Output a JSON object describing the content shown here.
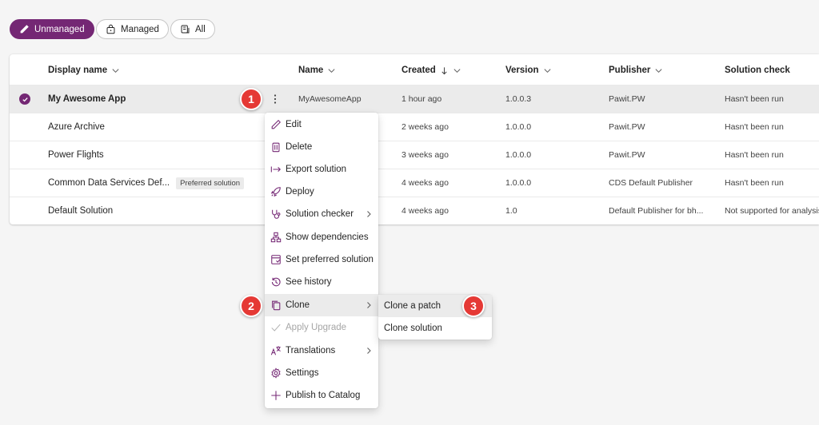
{
  "filters": [
    {
      "label": "Unmanaged",
      "active": true
    },
    {
      "label": "Managed",
      "active": false
    },
    {
      "label": "All",
      "active": false
    }
  ],
  "table": {
    "columns": {
      "display_name": "Display name",
      "name": "Name",
      "created": "Created",
      "version": "Version",
      "publisher": "Publisher",
      "solution_check": "Solution check"
    },
    "rows": [
      {
        "display_name": "My Awesome App",
        "tag": "",
        "name": "MyAwesomeApp",
        "created": "1 hour ago",
        "version": "1.0.0.3",
        "publisher": "Pawit.PW",
        "solution_check": "Hasn't been run"
      },
      {
        "display_name": "Azure Archive",
        "tag": "",
        "name": "",
        "created": "2 weeks ago",
        "version": "1.0.0.0",
        "publisher": "Pawit.PW",
        "solution_check": "Hasn't been run"
      },
      {
        "display_name": "Power Flights",
        "tag": "",
        "name": "",
        "created": "3 weeks ago",
        "version": "1.0.0.0",
        "publisher": "Pawit.PW",
        "solution_check": "Hasn't been run"
      },
      {
        "display_name": "Common Data Services Def...",
        "tag": "Preferred solution",
        "name": "",
        "created": "4 weeks ago",
        "version": "1.0.0.0",
        "publisher": "CDS Default Publisher",
        "solution_check": "Hasn't been run"
      },
      {
        "display_name": "Default Solution",
        "tag": "",
        "name": "",
        "created": "4 weeks ago",
        "version": "1.0",
        "publisher": "Default Publisher for bh...",
        "solution_check": "Not supported for analysis"
      }
    ]
  },
  "menu": {
    "items": [
      {
        "label": "Edit",
        "icon": "pencil-icon"
      },
      {
        "label": "Delete",
        "icon": "trash-icon"
      },
      {
        "label": "Export solution",
        "icon": "export-arrow-icon"
      },
      {
        "label": "Deploy",
        "icon": "rocket-icon"
      },
      {
        "label": "Solution checker",
        "icon": "stethoscope-icon"
      },
      {
        "label": "Show dependencies",
        "icon": "hierarchy-icon"
      },
      {
        "label": "Set preferred solution",
        "icon": "preferred-icon"
      },
      {
        "label": "See history",
        "icon": "history-icon"
      },
      {
        "label": "Clone",
        "icon": "copy-icon"
      },
      {
        "label": "Apply Upgrade",
        "icon": "checkmark-icon"
      },
      {
        "label": "Translations",
        "icon": "translate-icon"
      },
      {
        "label": "Settings",
        "icon": "gear-icon"
      },
      {
        "label": "Publish to Catalog",
        "icon": "plus-icon"
      }
    ],
    "submenu": [
      {
        "label": "Clone a patch"
      },
      {
        "label": "Clone solution"
      }
    ]
  },
  "badges": [
    "1",
    "2",
    "3"
  ],
  "colors": {
    "accent": "#742774",
    "badge": "#e53935",
    "selected_row": "#ebebeb"
  }
}
